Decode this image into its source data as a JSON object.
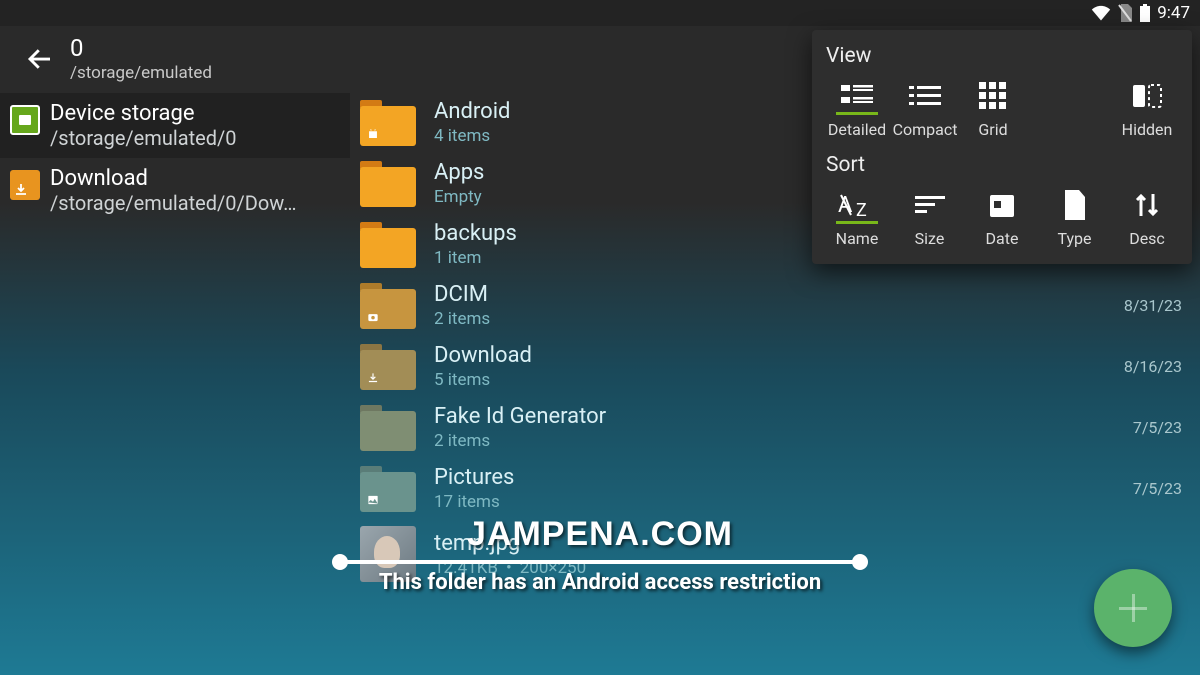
{
  "statusbar": {
    "time": "9:47"
  },
  "header": {
    "title": "0",
    "subtitle": "/storage/emulated"
  },
  "sidebar": {
    "items": [
      {
        "title": "Device storage",
        "path": "/storage/emulated/0"
      },
      {
        "title": "Download",
        "path": "/storage/emulated/0/Dow…"
      }
    ]
  },
  "files": [
    {
      "name": "Android",
      "sub": "4 items",
      "date": ""
    },
    {
      "name": "Apps",
      "sub": "Empty",
      "date": ""
    },
    {
      "name": "backups",
      "sub": "1 item",
      "date": ""
    },
    {
      "name": "DCIM",
      "sub": "2 items",
      "date": "8/31/23"
    },
    {
      "name": "Download",
      "sub": "5 items",
      "date": "8/16/23"
    },
    {
      "name": "Fake Id Generator",
      "sub": "2 items",
      "date": "7/5/23"
    },
    {
      "name": "Pictures",
      "sub": "17 items",
      "date": "7/5/23"
    },
    {
      "name": "temp.jpg",
      "sub": "12.41KB",
      "dim": "200×250",
      "date": ""
    }
  ],
  "popup": {
    "view_label": "View",
    "sort_label": "Sort",
    "view": [
      {
        "label": "Detailed"
      },
      {
        "label": "Compact"
      },
      {
        "label": "Grid"
      },
      {
        "label": "Hidden"
      }
    ],
    "sort": [
      {
        "label": "Name"
      },
      {
        "label": "Size"
      },
      {
        "label": "Date"
      },
      {
        "label": "Type"
      },
      {
        "label": "Desc"
      }
    ]
  },
  "watermark": {
    "title": "JAMPENA.COM",
    "caption": "This folder has an Android access restriction"
  }
}
